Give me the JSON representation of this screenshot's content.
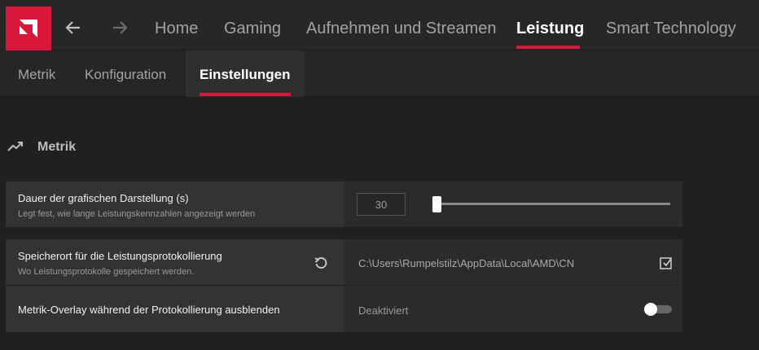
{
  "header": {
    "tabs": [
      {
        "label": "Home"
      },
      {
        "label": "Gaming"
      },
      {
        "label": "Aufnehmen und Streamen"
      },
      {
        "label": "Leistung"
      },
      {
        "label": "Smart Technology"
      }
    ],
    "active_tab": "Leistung"
  },
  "subnav": {
    "tabs": [
      {
        "label": "Metrik"
      },
      {
        "label": "Konfiguration"
      },
      {
        "label": "Einstellungen"
      }
    ],
    "active_tab": "Einstellungen"
  },
  "section": {
    "title": "Metrik",
    "icon": "trending-up-icon"
  },
  "settings": {
    "duration": {
      "title": "Dauer der grafischen Darstellung (s)",
      "desc": "Legt fest, wie lange Leistungskennzahlen angezeigt werden",
      "value": "30",
      "slider_level": 0
    },
    "log_path": {
      "title": "Speicherort für die Leistungsprotokollierung",
      "desc": "Wo Leistungsprotokolle gespeichert werden.",
      "value": "C:\\Users\\Rumpelstilz\\AppData\\Local\\AMD\\CN"
    },
    "hide_overlay": {
      "title": "Metrik-Overlay während der Protokollierung ausblenden",
      "value": "Deaktiviert",
      "enabled": false
    }
  },
  "colors": {
    "accent": "#d9173a",
    "background": "#202020"
  }
}
